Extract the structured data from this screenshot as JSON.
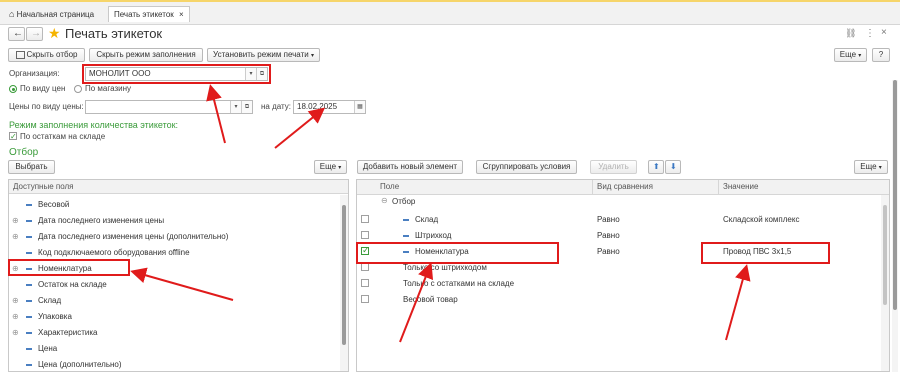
{
  "tabs": [
    {
      "label": "Начальная страница"
    },
    {
      "label": "Печать этикеток",
      "close": "×"
    }
  ],
  "header": {
    "title": "Печать этикеток",
    "back": "←",
    "forward": "→",
    "link_icon": "🔗",
    "more_icon": "⋮",
    "close_icon": "×"
  },
  "toolbar": {
    "hide_filter": "Скрыть отбор",
    "hide_fill_mode": "Скрыть режим заполнения",
    "set_print_mode": "Установить режим печати",
    "more": "Еще",
    "help": "?"
  },
  "form": {
    "org_label": "Организация:",
    "org_value": "МОНОЛИТ ООО",
    "radio_by_price": "По виду цен",
    "radio_by_store": "По магазину",
    "price_label": "Цены по виду цены:",
    "date_label": "на дату:",
    "date_value": "18.02.2025",
    "fill_mode_title": "Режим заполнения количества этикеток:",
    "by_stock_label": "По остаткам на складе",
    "filter_title": "Отбор"
  },
  "left_panel": {
    "select_btn": "Выбрать",
    "more": "Еще",
    "header": "Доступные поля",
    "items": [
      {
        "label": "Весовой",
        "expand": ""
      },
      {
        "label": "Дата последнего изменения цены",
        "expand": "⊕"
      },
      {
        "label": "Дата последнего изменения цены (дополнительно)",
        "expand": "⊕"
      },
      {
        "label": "Код подключаемого оборудования offline",
        "expand": ""
      },
      {
        "label": "Номенклатура",
        "expand": "⊕"
      },
      {
        "label": "Остаток на складе",
        "expand": ""
      },
      {
        "label": "Склад",
        "expand": "⊕"
      },
      {
        "label": "Упаковка",
        "expand": "⊕"
      },
      {
        "label": "Характеристика",
        "expand": "⊕"
      },
      {
        "label": "Цена",
        "expand": ""
      },
      {
        "label": "Цена (дополнительно)",
        "expand": ""
      }
    ]
  },
  "right_panel": {
    "add_btn": "Добавить новый элемент",
    "group_btn": "Сгруппировать условия",
    "delete_btn": "Удалить",
    "up": "⬆",
    "down": "⬇",
    "more": "Еще",
    "columns": [
      "Поле",
      "Вид сравнения",
      "Значение"
    ],
    "group_row": "Отбор",
    "rows": [
      {
        "field": "Склад",
        "comparison": "Равно",
        "value": "Складской комплекс",
        "checked": false,
        "indent": true
      },
      {
        "field": "Штрихкод",
        "comparison": "Равно",
        "value": "",
        "checked": false,
        "indent": true
      },
      {
        "field": "Номенклатура",
        "comparison": "Равно",
        "value": "Провод ПВС 3х1,5",
        "checked": true,
        "indent": true
      },
      {
        "field": "Только со штрихкодом",
        "comparison": "",
        "value": "",
        "checked": false,
        "indent": false
      },
      {
        "field": "Только с остатками на складе",
        "comparison": "",
        "value": "",
        "checked": false,
        "indent": false
      },
      {
        "field": "Весовой товар",
        "comparison": "",
        "value": "",
        "checked": false,
        "indent": false
      }
    ]
  },
  "colors": {
    "annotation": "#e01b1b",
    "accent_green": "#3a9b3a",
    "star": "#f5b400"
  }
}
